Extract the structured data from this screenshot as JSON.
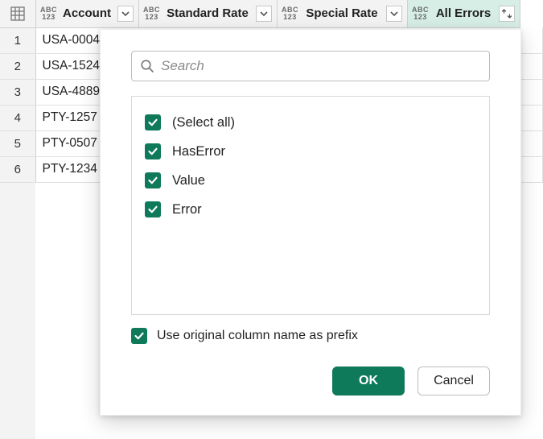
{
  "colors": {
    "accent": "#0f7a5a"
  },
  "grid": {
    "columns": [
      {
        "name": "Account",
        "active": false,
        "control": "filter"
      },
      {
        "name": "Standard Rate",
        "active": false,
        "control": "filter"
      },
      {
        "name": "Special Rate",
        "active": false,
        "control": "filter"
      },
      {
        "name": "All Errors",
        "active": true,
        "control": "expand"
      }
    ],
    "rows": [
      {
        "index": 1,
        "cells": [
          "USA-0004"
        ]
      },
      {
        "index": 2,
        "cells": [
          "USA-1524"
        ]
      },
      {
        "index": 3,
        "cells": [
          "USA-4889"
        ]
      },
      {
        "index": 4,
        "cells": [
          "PTY-1257"
        ]
      },
      {
        "index": 5,
        "cells": [
          "PTY-0507"
        ]
      },
      {
        "index": 6,
        "cells": [
          "PTY-1234"
        ]
      }
    ]
  },
  "dialog": {
    "search_placeholder": "Search",
    "options": [
      {
        "label": "(Select all)",
        "checked": true
      },
      {
        "label": "HasError",
        "checked": true
      },
      {
        "label": "Value",
        "checked": true
      },
      {
        "label": "Error",
        "checked": true
      }
    ],
    "prefix_label": "Use original column name as prefix",
    "prefix_checked": true,
    "ok_label": "OK",
    "cancel_label": "Cancel"
  }
}
